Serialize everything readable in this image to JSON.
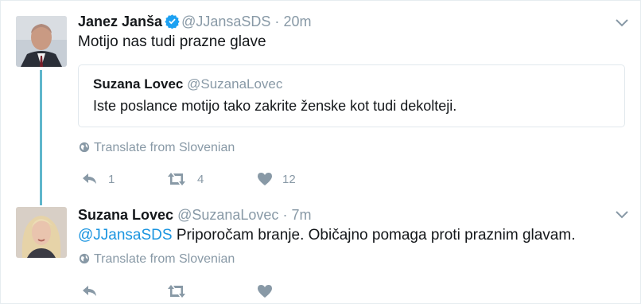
{
  "tweets": [
    {
      "name": "Janez Janša",
      "handle": "@JJansaSDS",
      "separator": "·",
      "time": "20m",
      "text": "Motijo nas tudi prazne glave",
      "quote": {
        "name": "Suzana Lovec",
        "handle": "@SuzanaLovec",
        "text": "Iste poslance motijo tako zakrite ženske kot tudi dekolteji."
      },
      "translate": "Translate from Slovenian",
      "actions": {
        "reply": "1",
        "retweet": "4",
        "like": "12"
      },
      "verified": true
    },
    {
      "name": "Suzana Lovec",
      "handle": "@SuzanaLovec",
      "separator": "·",
      "time": "7m",
      "mention": "@JJansaSDS",
      "text": " Priporočam branje. Običajno pomaga proti praznim glavam.",
      "translate": "Translate from Slovenian",
      "actions": {
        "reply": "",
        "retweet": "",
        "like": ""
      }
    }
  ],
  "colors": {
    "text": "#14171a",
    "muted": "#8899a6",
    "link": "#1b95e0",
    "thread": "#5fb6cc",
    "border": "#e1e8ed"
  },
  "icons": [
    "verified-badge-icon",
    "chevron-down-icon",
    "globe-icon",
    "reply-icon",
    "retweet-icon",
    "like-icon"
  ]
}
